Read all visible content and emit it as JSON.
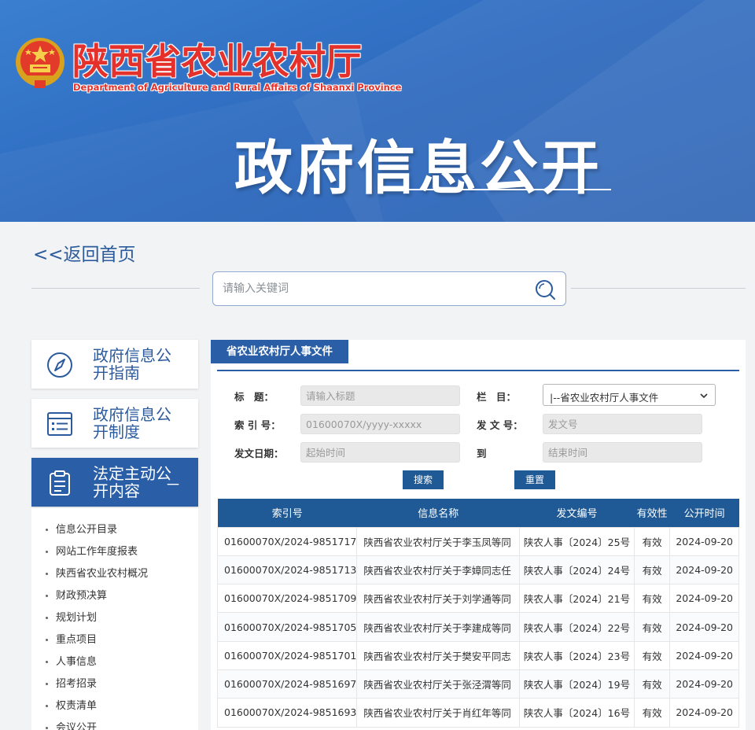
{
  "header": {
    "site_name": "陕西省农业农村厅",
    "site_name_en": "Department of Agriculture and Rural Affairs of Shaanxi Province",
    "banner_title": "政府信息公开"
  },
  "back_link": "<<返回首页",
  "search": {
    "placeholder": "请输入关键词"
  },
  "nav": {
    "cards": [
      {
        "label": "政府信息公开指南",
        "icon": "compass-icon"
      },
      {
        "label": "政府信息公开制度",
        "icon": "list-icon"
      },
      {
        "label": "法定主动公开内容",
        "icon": "clipboard-icon",
        "expanded_mark": "－"
      }
    ],
    "sub_items": [
      "信息公开目录",
      "网站工作年度报表",
      "陕西省农业农村概况",
      "财政预决算",
      "规划计划",
      "重点项目",
      "人事信息",
      "招考招录",
      "权责清单",
      "会议公开"
    ]
  },
  "content": {
    "tab_title": "省农业农村厅人事文件",
    "form": {
      "title_label": "标　题：",
      "title_placeholder": "请输入标题",
      "column_label": "栏　目：",
      "column_value": "|--省农业农村厅人事文件",
      "index_label": "索 引 号：",
      "index_placeholder": "01600070X/yyyy-xxxxx",
      "docno_label": "发 文 号：",
      "docno_placeholder": "发文号",
      "date_label": "发文日期：",
      "start_placeholder": "起始时间",
      "to_label": "到",
      "end_placeholder": "结束时间",
      "search_btn": "搜索",
      "reset_btn": "重置"
    },
    "table": {
      "headers": [
        "索引号",
        "信息名称",
        "发文编号",
        "有效性",
        "公开时间"
      ],
      "rows": [
        [
          "01600070X/2024-9851717",
          "陕西省农业农村厅关于李玉凤等同",
          "陕农人事〔2024〕25号",
          "有效",
          "2024-09-20"
        ],
        [
          "01600070X/2024-9851713",
          "陕西省农业农村厅关于李嫜同志任",
          "陕农人事〔2024〕24号",
          "有效",
          "2024-09-20"
        ],
        [
          "01600070X/2024-9851709",
          "陕西省农业农村厅关于刘学通等同",
          "陕农人事〔2024〕21号",
          "有效",
          "2024-09-20"
        ],
        [
          "01600070X/2024-9851705",
          "陕西省农业农村厅关于李建成等同",
          "陕农人事〔2024〕22号",
          "有效",
          "2024-09-20"
        ],
        [
          "01600070X/2024-9851701",
          "陕西省农业农村厅关于樊安平同志",
          "陕农人事〔2024〕23号",
          "有效",
          "2024-09-20"
        ],
        [
          "01600070X/2024-9851697",
          "陕西省农业农村厅关于张泾渭等同",
          "陕农人事〔2024〕19号",
          "有效",
          "2024-09-20"
        ],
        [
          "01600070X/2024-9851693",
          "陕西省农业农村厅关于肖红年等同",
          "陕农人事〔2024〕16号",
          "有效",
          "2024-09-20"
        ]
      ]
    }
  }
}
